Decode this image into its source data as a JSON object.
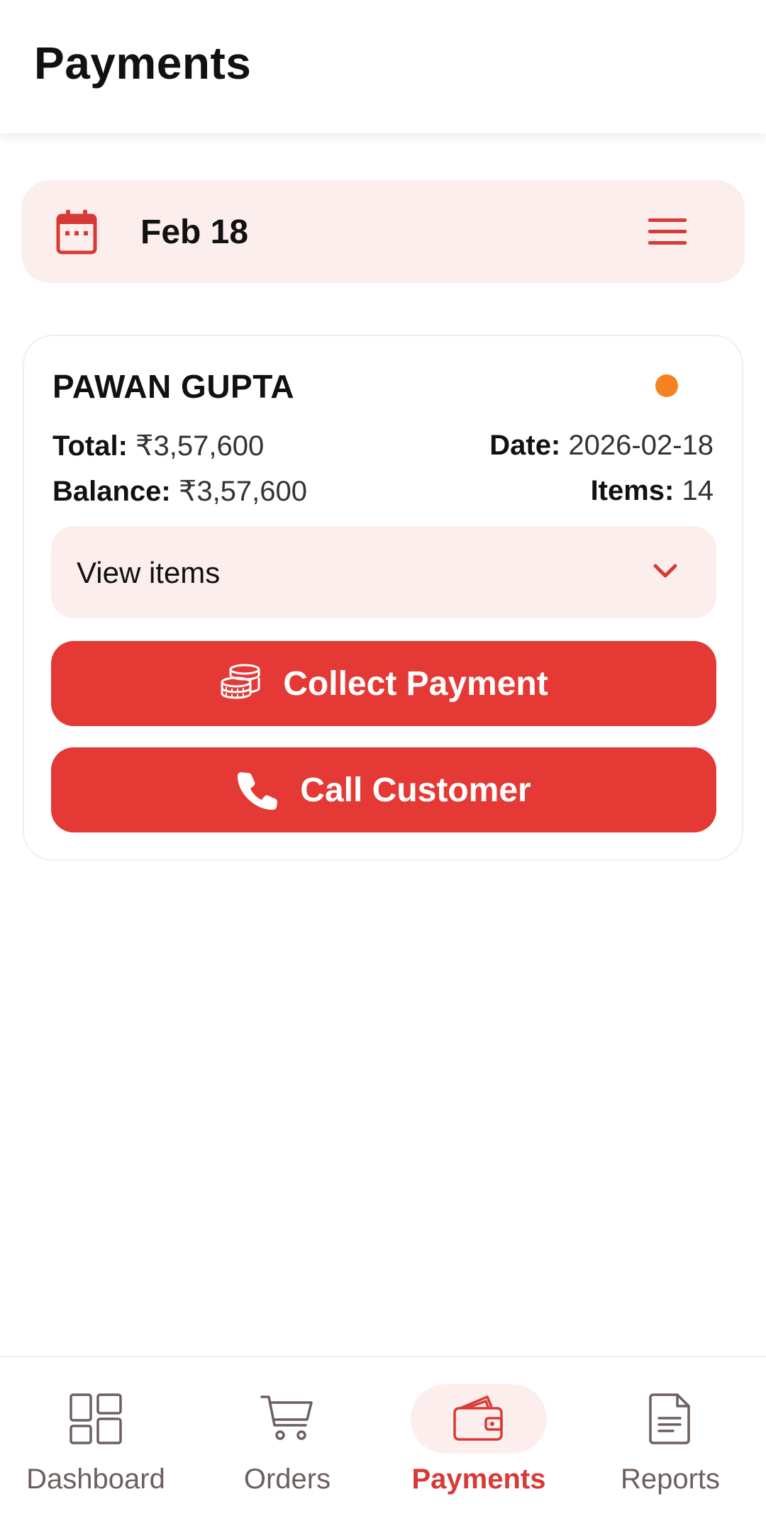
{
  "header": {
    "title": "Payments"
  },
  "date_filter": {
    "label": "Feb 18",
    "icon": "calendar-icon",
    "menu_icon": "menu-icon"
  },
  "order_card": {
    "customer_name": "PAWAN GUPTA",
    "status_color": "#f5821f",
    "total_label": "Total:",
    "total_value": "₹3,57,600",
    "date_label": "Date:",
    "date_value": "2026-02-18",
    "balance_label": "Balance:",
    "balance_value": "₹3,57,600",
    "items_label": "Items:",
    "items_value": "14",
    "view_items_label": "View items",
    "collect_payment_label": "Collect Payment",
    "call_customer_label": "Call Customer"
  },
  "bottom_nav": {
    "items": [
      {
        "label": "Dashboard",
        "icon": "dashboard-icon",
        "active": false
      },
      {
        "label": "Orders",
        "icon": "cart-icon",
        "active": false
      },
      {
        "label": "Payments",
        "icon": "wallet-icon",
        "active": true
      },
      {
        "label": "Reports",
        "icon": "document-icon",
        "active": false
      }
    ]
  },
  "colors": {
    "accent": "#e53935",
    "accent_light": "#fdeeee",
    "nav_inactive": "#6d5f5f",
    "nav_active": "#d83a35"
  }
}
